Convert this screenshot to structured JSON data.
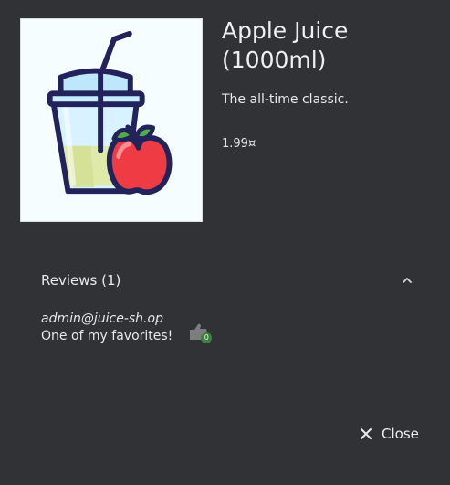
{
  "product": {
    "name": "Apple Juice (1000ml)",
    "description": "The all-time classic.",
    "price": "1.99¤",
    "image_icon": "apple-juice-cup-illustration"
  },
  "reviews": {
    "title": "Reviews (1)",
    "expanded": true,
    "items": [
      {
        "author": "admin@juice-sh.op",
        "text": "One of my favorites!",
        "likes": "0"
      }
    ]
  },
  "actions": {
    "close_label": "Close"
  },
  "colors": {
    "background": "#303236",
    "like_badge": "#3f7f3f",
    "text": "#e8e8e8"
  }
}
